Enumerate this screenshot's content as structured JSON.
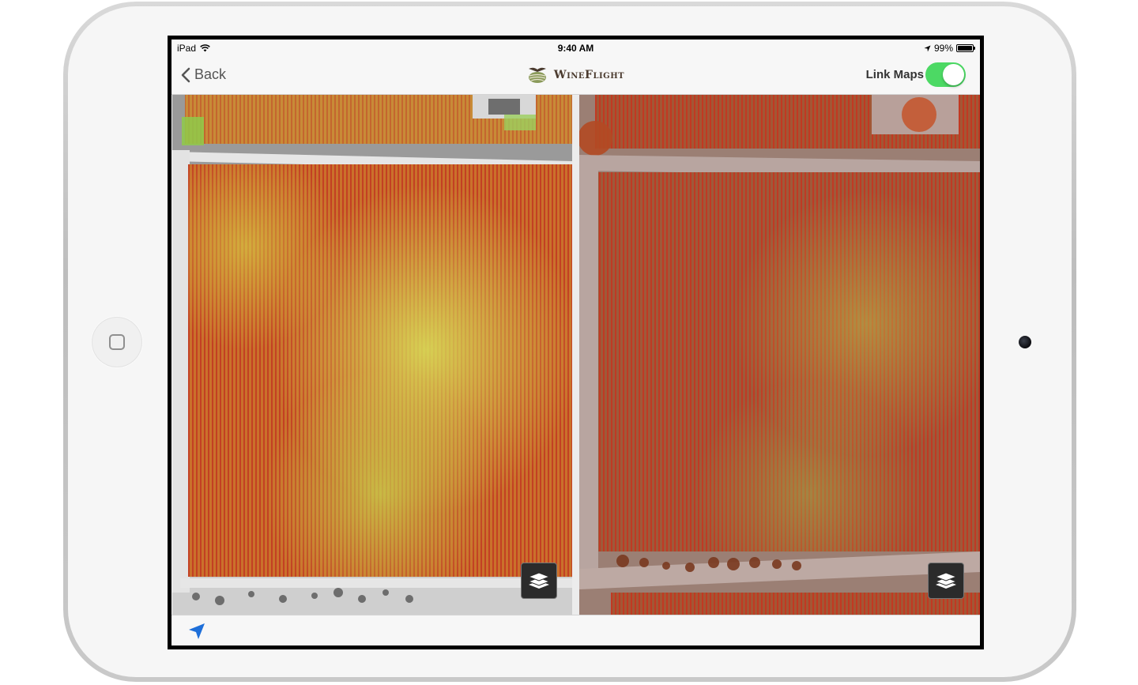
{
  "status_bar": {
    "carrier": "iPad",
    "time": "9:40 AM",
    "battery_percent": "99%",
    "battery_level": 0.99
  },
  "nav": {
    "back_label": "Back",
    "app_name": "WineFlight",
    "link_maps_label": "Link Maps",
    "link_maps_on": true
  },
  "maps": {
    "left": {
      "overlay": "vigor-heatmap",
      "base": "grayscale-aerial"
    },
    "right": {
      "overlay": "vigor-heatmap",
      "base": "color-aerial"
    }
  },
  "icons": {
    "back": "chevron-left-icon",
    "wifi": "wifi-icon",
    "location_arrow": "location-arrow-icon",
    "battery": "battery-icon",
    "layers": "layers-icon",
    "locate": "locate-arrow-icon",
    "logo": "wineflight-logo-icon"
  },
  "colors": {
    "toggle_on": "#4cd964",
    "locate_blue": "#1e6fd9",
    "heat_red": "#c8321e",
    "heat_orange": "#e07a28",
    "heat_yellow": "#d9d548",
    "heat_green": "#98c84a"
  }
}
